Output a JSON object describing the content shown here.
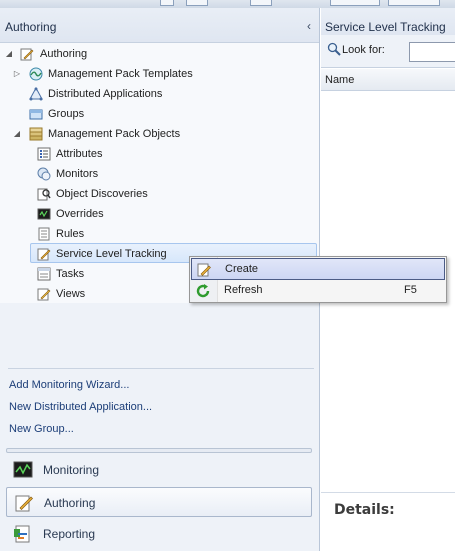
{
  "navigation_pane": {
    "header_title": "Authoring",
    "collapse_glyph": "‹",
    "tree": [
      {
        "label": "Authoring",
        "icon": "authoring-icon",
        "expander": "◢"
      },
      {
        "label": "Management Pack Templates",
        "icon": "management-pack-templates-icon",
        "expander": "▷"
      },
      {
        "label": "Distributed Applications",
        "icon": "distributed-applications-icon"
      },
      {
        "label": "Groups",
        "icon": "groups-icon"
      },
      {
        "label": "Management Pack Objects",
        "icon": "management-pack-objects-icon",
        "expander": "◢"
      },
      {
        "label": "Attributes",
        "icon": "attributes-icon"
      },
      {
        "label": "Monitors",
        "icon": "monitors-icon"
      },
      {
        "label": "Object Discoveries",
        "icon": "object-discoveries-icon"
      },
      {
        "label": "Overrides",
        "icon": "overrides-icon"
      },
      {
        "label": "Rules",
        "icon": "rules-icon"
      },
      {
        "label": "Service Level Tracking",
        "icon": "service-level-tracking-icon",
        "selected": true
      },
      {
        "label": "Tasks",
        "icon": "tasks-icon"
      },
      {
        "label": "Views",
        "icon": "views-icon"
      }
    ],
    "tasks": [
      {
        "label": "Add Monitoring Wizard..."
      },
      {
        "label": "New Distributed Application..."
      },
      {
        "label": "New Group..."
      }
    ],
    "wunderbar": [
      {
        "label": "Monitoring",
        "icon": "monitoring-icon"
      },
      {
        "label": "Authoring",
        "icon": "authoring-icon",
        "active": true
      },
      {
        "label": "Reporting",
        "icon": "reporting-icon"
      }
    ]
  },
  "results_pane": {
    "header_title": "Service Level Tracking",
    "look_for_label": "Look for:",
    "look_for_value": "",
    "column_name": "Name",
    "details_label": "Details:"
  },
  "context_menu": {
    "items": [
      {
        "label": "Create",
        "icon": "create-icon",
        "shortcut": "",
        "highlighted": true
      },
      {
        "label": "Refresh",
        "icon": "refresh-icon",
        "shortcut": "F5"
      }
    ]
  },
  "colors": {
    "selection_fill": "#d7e7fb",
    "selection_border": "#a7c6ee",
    "menu_highlight": "#cdd6f4",
    "link_text": "#1c3e78"
  }
}
